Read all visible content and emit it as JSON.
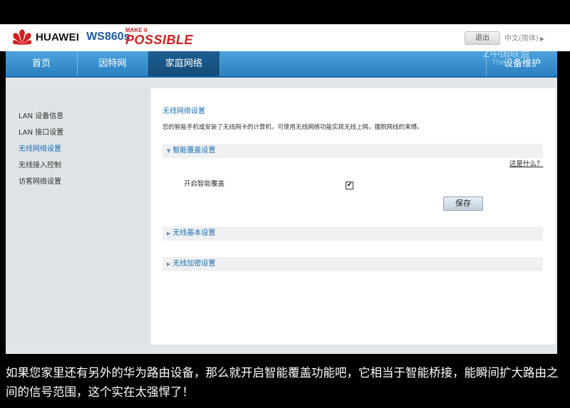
{
  "header": {
    "brand": "HUAWEI",
    "model": "WS860s",
    "slogan_top": "MAKE it",
    "slogan_bottom": "POSSIBLE",
    "logout_label": "退出",
    "language_label": "中文(简体)"
  },
  "nav": {
    "items": [
      {
        "label": "首页"
      },
      {
        "label": "因特网"
      },
      {
        "label": "家庭网络"
      },
      {
        "label": "设备维护"
      }
    ],
    "active": "家庭网络"
  },
  "watermark": {
    "line1": "Z中国联盟",
    "line2": "The"
  },
  "sidebar": {
    "items": [
      {
        "label": "LAN 设备信息"
      },
      {
        "label": "LAN 接口设置"
      },
      {
        "label": "无线网络设置"
      },
      {
        "label": "无线接入控制"
      },
      {
        "label": "访客网络设置"
      }
    ],
    "active": "无线网络设置"
  },
  "main": {
    "title": "无线网络设置",
    "description": "您的智能手机或安装了无线网卡的计算机，可使用无线网络功能实现无线上网，摆脱网线的束缚。",
    "panels": [
      {
        "label": "智能覆盖设置",
        "expanded": true
      },
      {
        "label": "无线基本设置",
        "expanded": false
      },
      {
        "label": "无线加密设置",
        "expanded": false
      }
    ],
    "help_link": "这是什么？",
    "smart_coverage_label": "开启智能覆盖",
    "smart_coverage_checked": true,
    "checkbox_mark": "✔",
    "save_label": "保存"
  },
  "caption": {
    "text": "如果您家里还有另外的华为路由设备，那么就开启智能覆盖功能吧，它相当于智能桥接，能瞬间扩大路由之间的信号范围，这个实在太强悍了！"
  },
  "colors": {
    "nav_blue": "#2a7fc0",
    "nav_active": "#154b77",
    "link_blue": "#1d6fb8",
    "brand_red": "#d41f1f"
  }
}
